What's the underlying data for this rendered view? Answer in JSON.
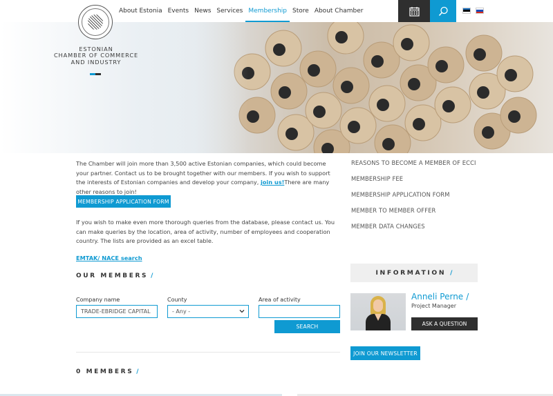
{
  "brand": {
    "name_lines": [
      "ESTONIAN",
      "CHAMBER OF COMMERCE",
      "AND INDUSTRY"
    ],
    "seal_icon": "chamber-seal-logo",
    "accent_colors": [
      "#0f9ad2",
      "#2f2f2f"
    ]
  },
  "nav": {
    "items": [
      {
        "label": "About Estonia",
        "active": false
      },
      {
        "label": "Events",
        "active": false
      },
      {
        "label": "News",
        "active": false
      },
      {
        "label": "Services",
        "active": false
      },
      {
        "label": "Membership",
        "active": true
      },
      {
        "label": "Store",
        "active": false
      },
      {
        "label": "About Chamber",
        "active": false
      }
    ],
    "calendar_icon": "calendar-icon",
    "search_icon": "search-icon",
    "languages": [
      {
        "code": "et",
        "icon": "estonia-flag-icon"
      },
      {
        "code": "ru",
        "icon": "russia-flag-icon"
      }
    ]
  },
  "hero": {
    "image_subject": "pencils"
  },
  "main": {
    "intro_text": "The Chamber will join more than 3,500 active Estonian companies, which could become your partner. Contact us to be brought together with our members. If you wish to support the interests of Estonian companies and develop your company,",
    "intro_link": "join us!",
    "intro_tail": "There are many other reasons to join!",
    "membership_form_button": "MEMBERSHIP APPLICATION FORM",
    "queries_text": "If you wish to make even more thorough queries from the database, please contact us. You can make queries by the location, area of activity, number of employees and cooperation country. The lists are provided as an excel table.",
    "emtak_link": "EMTAK/ NACE search",
    "our_members_title": "OUR MEMBERS",
    "title_slash": "/",
    "filters": {
      "company_label": "Company name",
      "company_value": "TRADE-EBRIDGE CAPITAL",
      "county_label": "County",
      "county_value": "- Any -",
      "activity_label": "Area of activity",
      "activity_value": ""
    },
    "search_button": "SEARCH",
    "members_count_title": "0 MEMBERS"
  },
  "sidebar": {
    "links": [
      "REASONS TO BECOME A MEMBER OF ECCI",
      "MEMBERSHIP FEE",
      "MEMBERSHIP APPLICATION FORM",
      "MEMBER TO MEMBER OFFER",
      "MEMBER DATA CHANGES"
    ],
    "info_title": "INFORMATION",
    "contact": {
      "name": "Anneli Perne",
      "role": "Project Manager",
      "ask_button": "ASK A QUESTION"
    },
    "newsletter_button": "JOIN OUR NEWSLETTER"
  }
}
